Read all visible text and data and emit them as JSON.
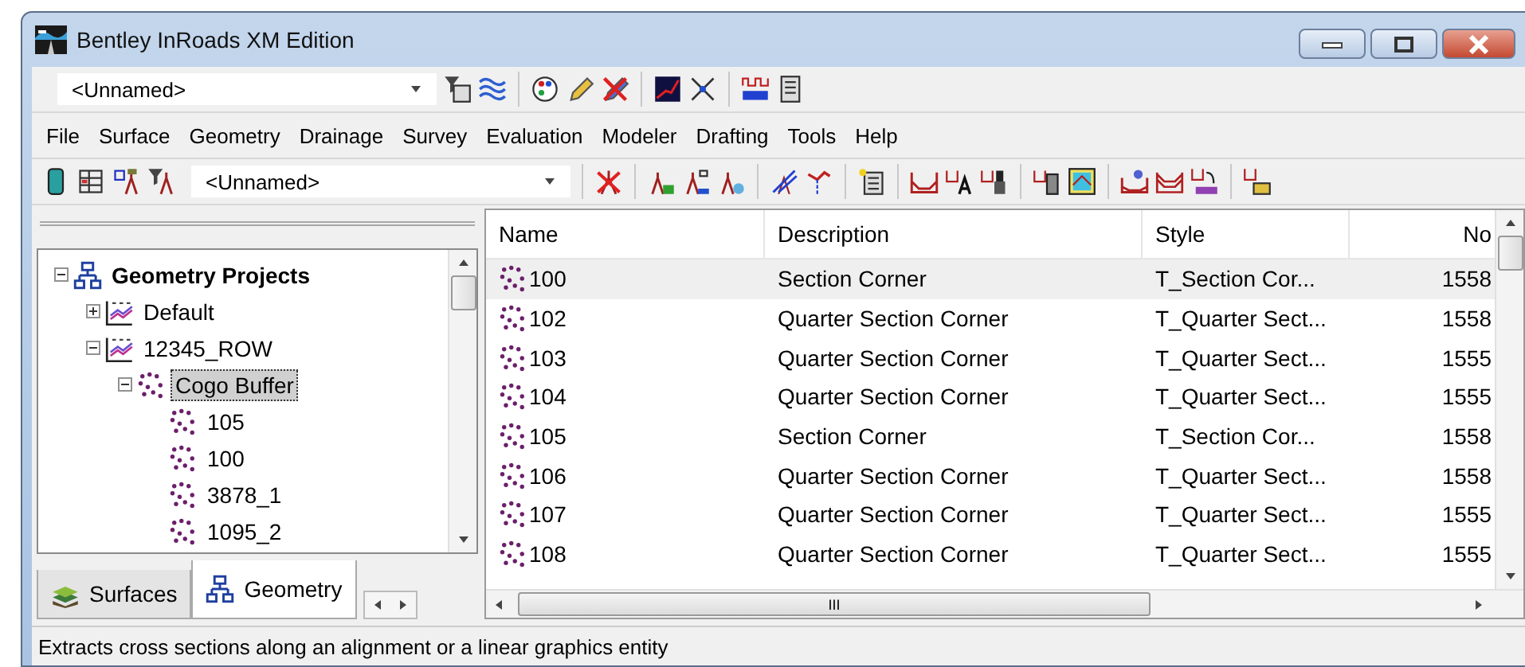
{
  "window": {
    "title": "Bentley InRoads XM Edition"
  },
  "toolbar_top": {
    "combo": "<Unnamed>"
  },
  "menu": [
    {
      "label": "File"
    },
    {
      "label": "Surface"
    },
    {
      "label": "Geometry"
    },
    {
      "label": "Drainage"
    },
    {
      "label": "Survey"
    },
    {
      "label": "Evaluation"
    },
    {
      "label": "Modeler"
    },
    {
      "label": "Drafting"
    },
    {
      "label": "Tools"
    },
    {
      "label": "Help"
    }
  ],
  "toolbar_second": {
    "combo": "<Unnamed>"
  },
  "tree": [
    {
      "label": "Geometry Projects",
      "kind": "root",
      "expanded": true,
      "selected": false,
      "children": [
        {
          "label": "Default",
          "kind": "project",
          "expanded": false,
          "selected": false
        },
        {
          "label": "12345_ROW",
          "kind": "project",
          "expanded": true,
          "selected": false,
          "children": [
            {
              "label": "Cogo Buffer",
              "kind": "points",
              "expanded": true,
              "selected": true,
              "children": [
                {
                  "label": "105",
                  "kind": "points",
                  "selected": false
                },
                {
                  "label": "100",
                  "kind": "points",
                  "selected": false
                },
                {
                  "label": "3878_1",
                  "kind": "points",
                  "selected": false
                },
                {
                  "label": "1095_2",
                  "kind": "points",
                  "selected": false
                }
              ]
            }
          ]
        }
      ]
    }
  ],
  "panel_tabs": [
    {
      "label": "Surfaces",
      "kind": "surfaces",
      "selected": false
    },
    {
      "label": "Geometry",
      "kind": "geometry",
      "selected": true
    }
  ],
  "table": {
    "columns": [
      "Name",
      "Description",
      "Style",
      "No"
    ],
    "rows": [
      {
        "cells": [
          "100",
          "Section Corner",
          "T_Section Cor...",
          "1558"
        ],
        "selected": true
      },
      {
        "cells": [
          "102",
          "Quarter Section Corner",
          "T_Quarter Sect...",
          "1558"
        ],
        "selected": false
      },
      {
        "cells": [
          "103",
          "Quarter Section Corner",
          "T_Quarter Sect...",
          "1555"
        ],
        "selected": false
      },
      {
        "cells": [
          "104",
          "Quarter Section Corner",
          "T_Quarter Sect...",
          "1555"
        ],
        "selected": false
      },
      {
        "cells": [
          "105",
          "Section Corner",
          "T_Section Cor...",
          "1558"
        ],
        "selected": false
      },
      {
        "cells": [
          "106",
          "Quarter Section Corner",
          "T_Quarter Sect...",
          "1558"
        ],
        "selected": false
      },
      {
        "cells": [
          "107",
          "Quarter Section Corner",
          "T_Quarter Sect...",
          "1555"
        ],
        "selected": false
      },
      {
        "cells": [
          "108",
          "Quarter Section Corner",
          "T_Quarter Sect...",
          "1555"
        ],
        "selected": false
      }
    ]
  },
  "scrollbar_grip": "III",
  "status_bar": "Extracts cross sections along an alignment or a linear graphics entity"
}
